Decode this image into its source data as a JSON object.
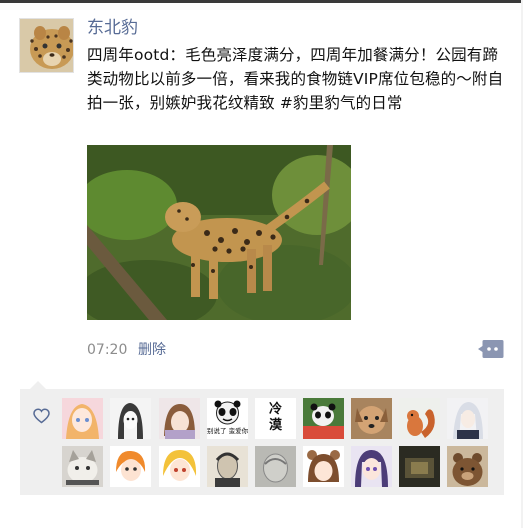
{
  "post": {
    "author": "东北豹",
    "text": "四周年ootd：毛色亮泽度满分，四周年加餐满分！公园有蹄类动物比以前多一倍，看来我的食物链VIP席位包稳的～附自拍一张，别嫉妒我花纹精致 #豹里豹气的日常",
    "time": "07:20",
    "delete_label": "删除"
  },
  "likes": {
    "row1": [
      {
        "name": "liker-1",
        "avatar": "anime-girl-pink"
      },
      {
        "name": "liker-2",
        "avatar": "anime-girl-sketch"
      },
      {
        "name": "liker-3",
        "avatar": "anime-girl-brown"
      },
      {
        "name": "liker-4",
        "avatar": "panda-meme",
        "caption": "别说了 蛮爱你"
      },
      {
        "name": "liker-5",
        "avatar": "calligraphy",
        "caption": "冷漠"
      },
      {
        "name": "liker-6",
        "avatar": "panda-red"
      },
      {
        "name": "liker-7",
        "avatar": "dog"
      },
      {
        "name": "liker-8",
        "avatar": "squirrel"
      },
      {
        "name": "liker-9",
        "avatar": "anime-white-hair"
      }
    ],
    "row2": [
      {
        "name": "liker-10",
        "avatar": "cat"
      },
      {
        "name": "liker-11",
        "avatar": "anime-orange-hair"
      },
      {
        "name": "liker-12",
        "avatar": "anime-blonde"
      },
      {
        "name": "liker-13",
        "avatar": "portrait-sketch"
      },
      {
        "name": "liker-14",
        "avatar": "grey-sketch"
      },
      {
        "name": "liker-15",
        "avatar": "anime-bear-ears"
      },
      {
        "name": "liker-16",
        "avatar": "anime-purple-hair"
      },
      {
        "name": "liker-17",
        "avatar": "dark-scene"
      },
      {
        "name": "liker-18",
        "avatar": "brown-bear"
      }
    ]
  },
  "icons": {
    "heart": "heart-icon",
    "comment": "comment-dots-icon"
  },
  "colors": {
    "link": "#576b95",
    "likes_bg": "#efefef",
    "meta": "#8c8c8c"
  }
}
